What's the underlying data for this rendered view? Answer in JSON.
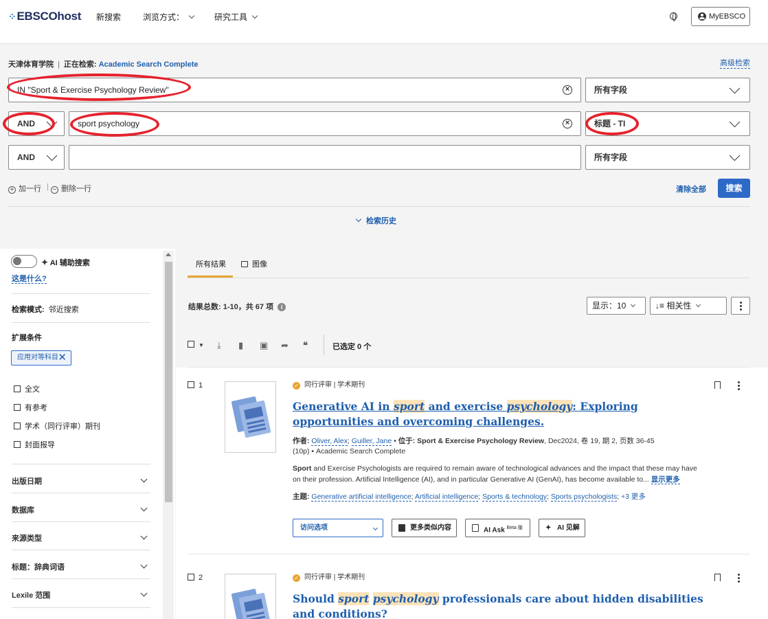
{
  "header": {
    "logo": "EBSCOhost",
    "nav": [
      "新搜索",
      "浏览方式：",
      "研究工具"
    ],
    "myebsco": "MyEBSCO"
  },
  "search": {
    "institution": "天津体育学院",
    "searching_label": "正在检索:",
    "database": "Academic Search Complete",
    "advanced": "高级检索",
    "rows": [
      {
        "value": "IN \"Sport & Exercise Psychology Review\"",
        "field": "所有字段"
      },
      {
        "op": "AND",
        "value": "sport psychology",
        "field": "标题 - TI"
      },
      {
        "op": "AND",
        "value": "",
        "field": "所有字段"
      }
    ],
    "add_row": "加一行",
    "remove_row": "删除一行",
    "clear_all": "清除全部",
    "search_button": "搜索",
    "history": "检索历史"
  },
  "sidebar": {
    "ai_label": "AI 辅助搜索",
    "what_is_this": "这是什么?",
    "mode_label": "检索模式:",
    "mode_value": "邻近搜索",
    "expanders": "扩展条件",
    "chip": "应用对等科目",
    "limiters": [
      "全文",
      "有参考",
      "学术（同行评审）期刊",
      "封面报导"
    ],
    "facets": [
      "出版日期",
      "数据库",
      "来源类型",
      "标题：辞典词语",
      "Lexile 范围"
    ]
  },
  "results": {
    "tabs": [
      "所有结果",
      "图像"
    ],
    "count_label": "结果总数:",
    "count_range": "1-10，共 67 项",
    "show_label": "显示：10",
    "sort_label": "相关性",
    "selected": "已选定 0 个",
    "items": [
      {
        "num": "1",
        "badges": "同行评审 | 学术期刊",
        "title_parts": [
          "Generative AI in ",
          "sport",
          " and exercise ",
          "psychology",
          ": Exploring opportunities and overcoming challenges."
        ],
        "author_label": "作者:",
        "authors": [
          "Oliver, Alex",
          "Guiller, Jane"
        ],
        "in_label": "位于:",
        "source": "Sport & Exercise Psychology Review",
        "details": ", Dec2024, 卷 19, 期 2, 页数 36-45",
        "details2": "(10p) • Academic Search Complete",
        "abstract_bold": "Sport",
        "abstract": " and Exercise Psychologists are required to remain aware of technological advances and the impact that these may have on their profession. Artificial Intelligence (AI), and in particular Generative AI (GenAI), has become available to...",
        "show_more": "显示更多",
        "subjects_label": "主题:",
        "subjects": [
          "Generative artificial intelligence",
          "Artificial intelligence",
          "Sports & technology",
          "Sports psychologists"
        ],
        "more_subjects": "+3 更多",
        "visit": "访问选项",
        "similar": "更多类似内容",
        "ai_ask": "AI Ask",
        "beta": "Beta 版",
        "ai_insight": "AI 见解"
      },
      {
        "num": "2",
        "badges": "同行评审 | 学术期刊",
        "title_parts": [
          "Should ",
          "sport",
          " ",
          "psychology",
          " professionals care about hidden disabilities and conditions?"
        ]
      }
    ]
  }
}
